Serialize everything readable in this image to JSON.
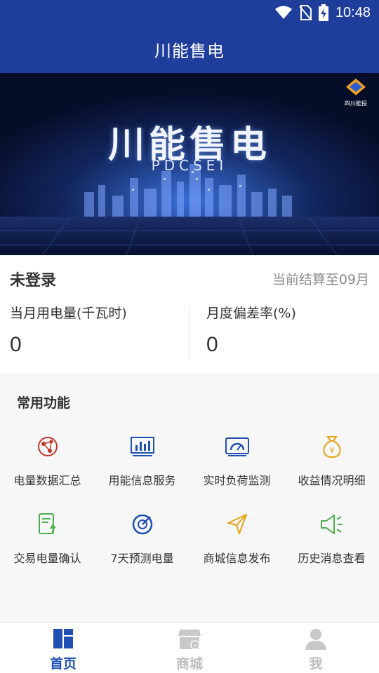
{
  "status_bar": {
    "time": "10:48",
    "icons": [
      "wifi-icon",
      "no-sim-icon",
      "battery-charging-icon"
    ]
  },
  "app_bar": {
    "title": "川能售电"
  },
  "banner": {
    "headline": "川能售电",
    "subtitle": "PDCSEI",
    "corner_brand": "四川能投"
  },
  "account": {
    "login_status": "未登录",
    "settlement_text": "当前结算至09月",
    "metrics": [
      {
        "label": "当月用电量(千瓦时)",
        "value": "0"
      },
      {
        "label": "月度偏差率(%)",
        "value": "0"
      }
    ]
  },
  "functions": {
    "title": "常用功能",
    "items": [
      {
        "label": "电量数据汇总",
        "icon": "globe-network-icon",
        "color": "#c0392b"
      },
      {
        "label": "用能信息服务",
        "icon": "bar-chart-monitor-icon",
        "color": "#1f4fb3"
      },
      {
        "label": "实时负荷监测",
        "icon": "gauge-screen-icon",
        "color": "#1f4fb3"
      },
      {
        "label": "收益情况明细",
        "icon": "money-bag-icon",
        "color": "#e8a316"
      },
      {
        "label": "交易电量确认",
        "icon": "document-bolt-icon",
        "color": "#4caf50"
      },
      {
        "label": "7天预测电量",
        "icon": "forecast-target-icon",
        "color": "#1f4fb3"
      },
      {
        "label": "商城信息发布",
        "icon": "send-arrow-icon",
        "color": "#e8a316"
      },
      {
        "label": "历史消息查看",
        "icon": "megaphone-icon",
        "color": "#4caf50"
      }
    ]
  },
  "tabs": [
    {
      "label": "首页",
      "icon": "home-grid-icon",
      "active": true
    },
    {
      "label": "商城",
      "icon": "store-icon",
      "active": false
    },
    {
      "label": "我",
      "icon": "user-icon",
      "active": false
    }
  ],
  "colors": {
    "primary": "#1f3e9b",
    "active_tab": "#1f4fb3",
    "inactive_tab": "#bdbdbd"
  }
}
